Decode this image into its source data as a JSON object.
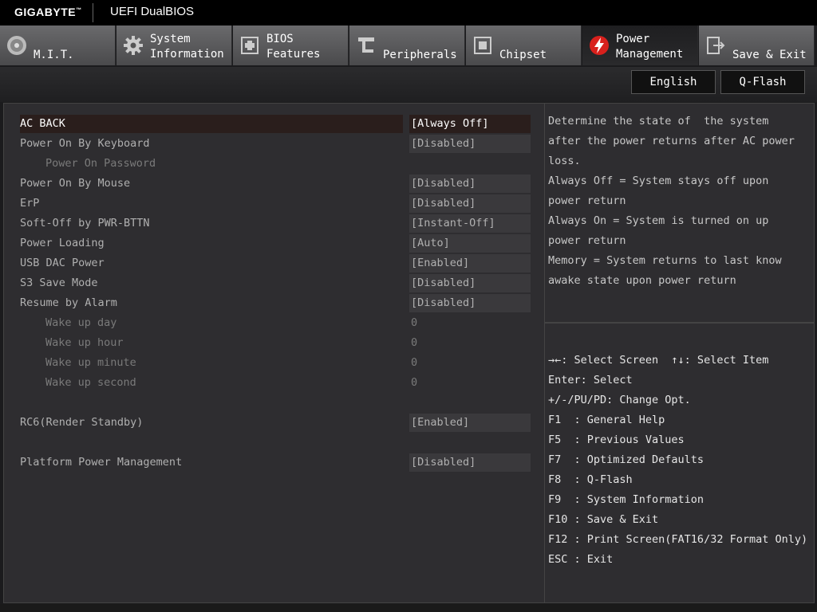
{
  "header": {
    "brand": "GIGABYTE",
    "brand_tm": "™",
    "title": "UEFI DualBIOS"
  },
  "tabs": [
    {
      "label": "M.I.T.",
      "icon": "speedometer-icon"
    },
    {
      "label": "System\nInformation",
      "icon": "gear-icon"
    },
    {
      "label": "BIOS\nFeatures",
      "icon": "chip-plus-icon"
    },
    {
      "label": "Peripherals",
      "icon": "plug-icon"
    },
    {
      "label": "Chipset",
      "icon": "chip-icon"
    },
    {
      "label": "Power\nManagement",
      "icon": "power-bolt-icon"
    },
    {
      "label": "Save & Exit",
      "icon": "exit-icon"
    }
  ],
  "active_tab": "Power\nManagement",
  "toolbar": {
    "language": "English",
    "qflash": "Q-Flash"
  },
  "settings": [
    {
      "label": "AC BACK",
      "value": "[Always Off]",
      "sub": false,
      "selected": true
    },
    {
      "label": "Power On By Keyboard",
      "value": "[Disabled]",
      "sub": false
    },
    {
      "label": "Power On Password",
      "value": "",
      "sub": true
    },
    {
      "label": "Power On By Mouse",
      "value": "[Disabled]",
      "sub": false
    },
    {
      "label": "ErP",
      "value": "[Disabled]",
      "sub": false
    },
    {
      "label": "Soft-Off by PWR-BTTN",
      "value": "[Instant-Off]",
      "sub": false
    },
    {
      "label": "Power Loading",
      "value": "[Auto]",
      "sub": false
    },
    {
      "label": "USB DAC Power",
      "value": "[Enabled]",
      "sub": false
    },
    {
      "label": "S3 Save Mode",
      "value": "[Disabled]",
      "sub": false
    },
    {
      "label": "Resume by Alarm",
      "value": "[Disabled]",
      "sub": false
    },
    {
      "label": "Wake up day",
      "value": "0",
      "sub": true
    },
    {
      "label": "Wake up hour",
      "value": "0",
      "sub": true
    },
    {
      "label": "Wake up minute",
      "value": "0",
      "sub": true
    },
    {
      "label": "Wake up second",
      "value": "0",
      "sub": true
    },
    {
      "label": "RC6(Render Standby)",
      "value": "[Enabled]",
      "sub": false
    },
    {
      "label": "Platform Power Management",
      "value": "[Disabled]",
      "sub": false
    }
  ],
  "help": [
    "Determine the state of  the system",
    "after the power returns after AC power",
    "loss.",
    "Always Off = System stays off upon",
    "power return",
    "Always On = System is turned on up",
    "power return",
    "Memory = System returns to last know",
    "awake state upon power return"
  ],
  "keys": [
    "→←: Select Screen  ↑↓: Select Item",
    "Enter: Select",
    "+/-/PU/PD: Change Opt.",
    "F1  : General Help",
    "F5  : Previous Values",
    "F7  : Optimized Defaults",
    "F8  : Q-Flash",
    "F9  : System Information",
    "F10 : Save & Exit",
    "F12 : Print Screen(FAT16/32 Format Only)",
    "ESC : Exit"
  ],
  "colors": {
    "accent": "#d8201c",
    "selected_bg": "#2a1e1c"
  }
}
